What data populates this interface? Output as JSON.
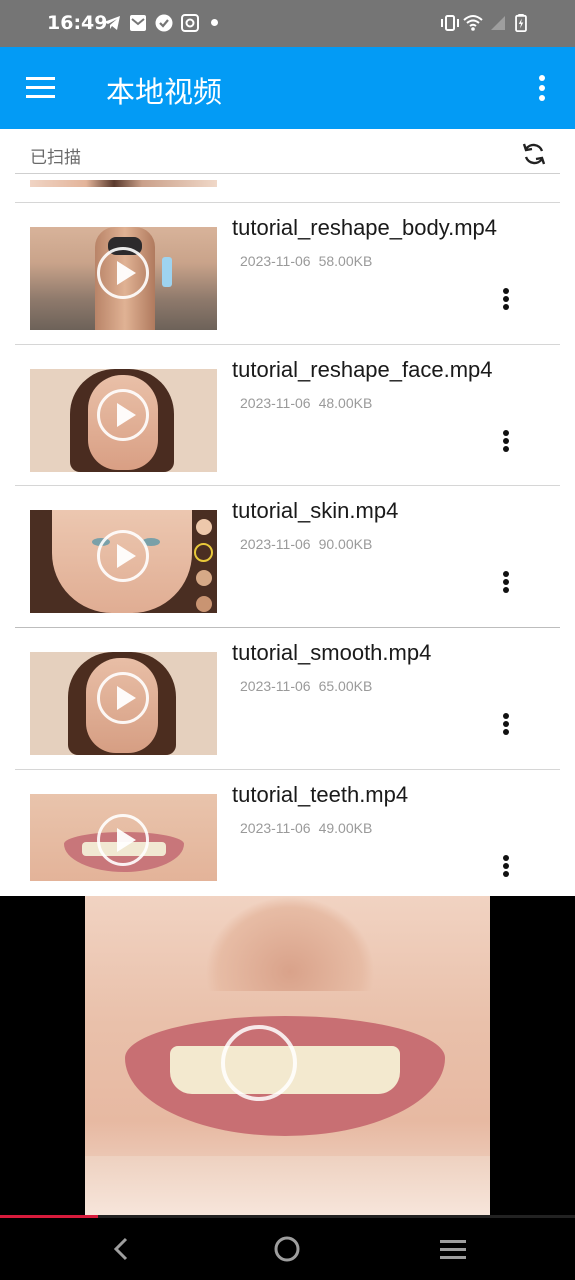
{
  "status_bar": {
    "time": "16:49",
    "left_icons": [
      "telegram-icon",
      "email-icon",
      "check-circle-icon",
      "photo-icon",
      "dot-icon"
    ],
    "right_icons": [
      "vibrate-icon",
      "wifi-icon",
      "signal-icon",
      "battery-charging-icon"
    ]
  },
  "app_bar": {
    "title": "本地视频",
    "bg_color": "#039bf5"
  },
  "scan_bar": {
    "label": "已扫描",
    "action_icon": "refresh-icon"
  },
  "videos": [
    {
      "title": "tutorial_reshape_body.mp4",
      "date": "2023-11-06",
      "size": "58.00KB"
    },
    {
      "title": "tutorial_reshape_face.mp4",
      "date": "2023-11-06",
      "size": "48.00KB"
    },
    {
      "title": "tutorial_skin.mp4",
      "date": "2023-11-06",
      "size": "90.00KB"
    },
    {
      "title": "tutorial_smooth.mp4",
      "date": "2023-11-06",
      "size": "65.00KB"
    },
    {
      "title": "tutorial_teeth.mp4",
      "date": "2023-11-06",
      "size": "49.00KB"
    }
  ],
  "player": {
    "progress": 0.17,
    "progress_color": "#d81b3c"
  },
  "nav_bar": {
    "buttons": [
      "back-icon",
      "home-icon",
      "recents-icon"
    ]
  }
}
